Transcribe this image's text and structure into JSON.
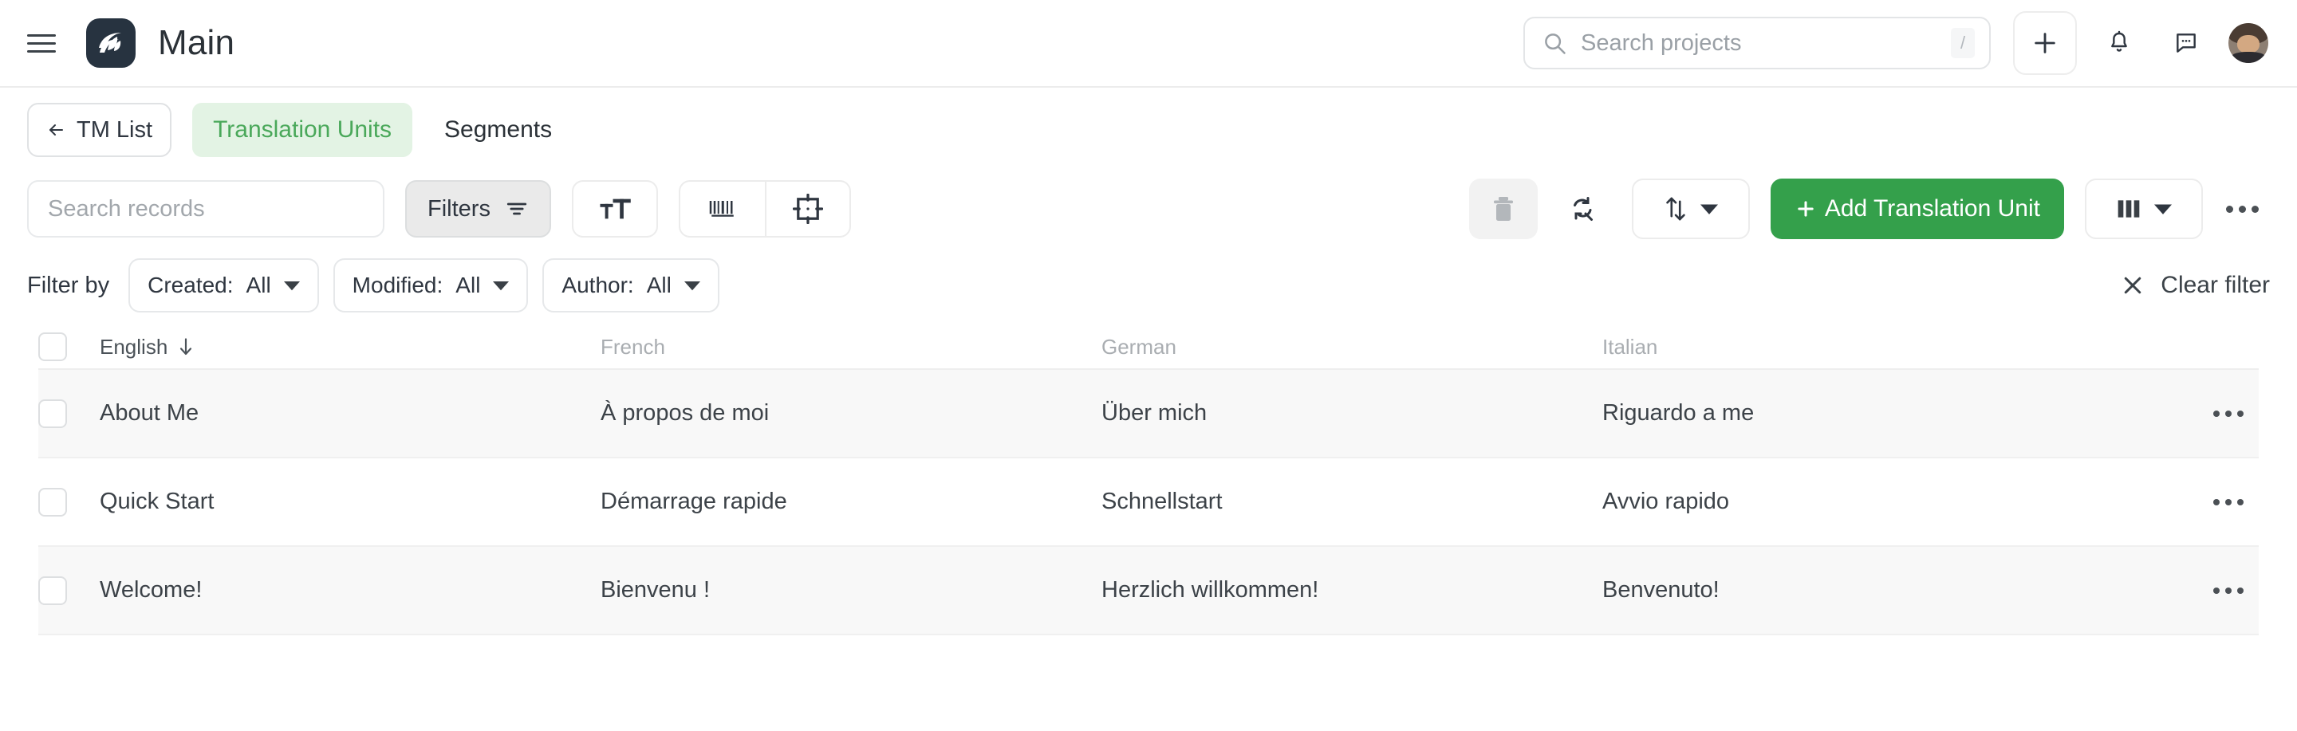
{
  "header": {
    "title": "Main",
    "menu_icon": "hamburger-icon",
    "logo_icon": "wordbee-logo-icon",
    "search": {
      "placeholder": "Search projects",
      "value": "",
      "icon": "search-icon",
      "shortcut": "/"
    },
    "add_icon": "plus-icon",
    "notifications_icon": "bell-icon",
    "messages_icon": "chat-bubble-icon",
    "avatar_icon": "user-avatar"
  },
  "tabs": {
    "back_button": {
      "label": "TM List",
      "icon": "arrow-left-icon"
    },
    "items": [
      {
        "label": "Translation Units",
        "active": true
      },
      {
        "label": "Segments",
        "active": false
      }
    ]
  },
  "toolbar": {
    "search": {
      "placeholder": "Search records",
      "value": ""
    },
    "filters_label": "Filters",
    "filters_icon": "filter-lines-icon",
    "text_size_icon": "text-size-icon",
    "barcode_icon": "barcode-icon",
    "target_icon": "crop-target-icon",
    "delete_icon": "trash-icon",
    "refresh_icon": "refresh-search-icon",
    "sort_icon": "sort-arrows-icon",
    "sort_caret_icon": "caret-down-icon",
    "add_label": "Add Translation Unit",
    "add_icon": "plus-icon",
    "columns_icon": "columns-icon",
    "columns_caret_icon": "caret-down-icon",
    "more_icon": "ellipsis-icon",
    "accent_color": "#34a04b"
  },
  "filter_bar": {
    "label": "Filter by",
    "chips": [
      {
        "name": "Created:",
        "value": "All"
      },
      {
        "name": "Modified:",
        "value": "All"
      },
      {
        "name": "Author:",
        "value": "All"
      }
    ],
    "clear_label": "Clear filter",
    "clear_icon": "close-icon"
  },
  "table": {
    "columns": [
      {
        "label": "English",
        "sorted": true,
        "sort_icon": "arrow-down-icon"
      },
      {
        "label": "French",
        "sorted": false
      },
      {
        "label": "German",
        "sorted": false
      },
      {
        "label": "Italian",
        "sorted": false
      }
    ],
    "rows": [
      {
        "english": "About Me",
        "french": "À propos de moi",
        "german": "Über mich",
        "italian": "Riguardo a me"
      },
      {
        "english": "Quick Start",
        "french": "Démarrage rapide",
        "german": "Schnellstart",
        "italian": "Avvio rapido"
      },
      {
        "english": "Welcome!",
        "french": "Bienvenu !",
        "german": "Herzlich willkommen!",
        "italian": "Benvenuto!"
      }
    ],
    "row_menu_icon": "ellipsis-icon"
  }
}
